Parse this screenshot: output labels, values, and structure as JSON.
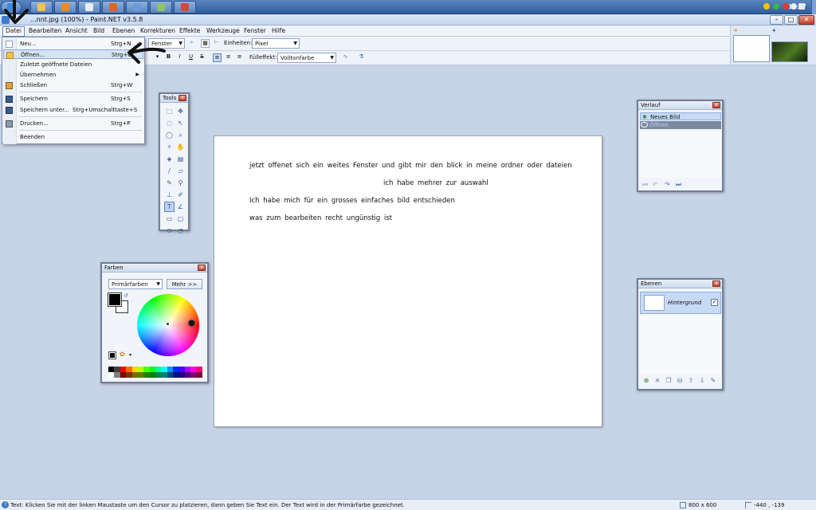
{
  "window": {
    "title": "...nnt.jpg (100%) - Paint.NET v3.5.8",
    "controls": {
      "minimize": "–",
      "maximize": "□",
      "close": "✕"
    }
  },
  "taskbar": {
    "clock": "19:57",
    "buttons": [
      {
        "icon": "windows-orb-icon",
        "color": "#3d8be0"
      },
      {
        "icon": "explorer-icon",
        "color": "#f0c24a"
      },
      {
        "icon": "media-player-icon",
        "color": "#f08a1e"
      },
      {
        "icon": "document-icon",
        "color": "#e8edf5"
      },
      {
        "icon": "firefox-icon",
        "color": "#e0642a"
      },
      {
        "icon": "paint-net-icon",
        "color": "#6d98d8"
      },
      {
        "icon": "image-viewer-icon",
        "color": "#8fc36a"
      },
      {
        "icon": "chrome-icon",
        "color": "#d8463a"
      }
    ]
  },
  "menubar": {
    "items": [
      "Datei",
      "Bearbeiten",
      "Ansicht",
      "Bild",
      "Ebenen",
      "Korrekturen",
      "Effekte",
      "Werkzeuge",
      "Fenster",
      "Hilfe"
    ]
  },
  "toolbar": {
    "font_combo": "Fenster",
    "units_label": "Einheiten:",
    "units_value": "Pixel",
    "fill_label": "Fülleffekt:",
    "fill_value": "Volltonfarbe",
    "style_buttons": [
      "B",
      "I",
      "U",
      "S"
    ]
  },
  "file_menu": {
    "items": [
      {
        "label": "Neu...",
        "shortcut": "Strg+N",
        "icon": "new-file-icon"
      },
      {
        "label": "Öffnen...",
        "shortcut": "Strg+O",
        "icon": "open-folder-icon",
        "highlighted": true
      },
      {
        "label": "Zuletzt geöffnete Dateien",
        "shortcut": "",
        "submenu": true
      },
      {
        "label": "Übernehmen",
        "shortcut": "",
        "submenu": true
      },
      {
        "label": "Schließen",
        "shortcut": "Strg+W",
        "icon": "close-file-icon"
      },
      {
        "label": "Speichern",
        "shortcut": "Strg+S",
        "icon": "save-icon"
      },
      {
        "label": "Speichern unter...",
        "shortcut": "Strg+Umschalttaste+S",
        "icon": "save-as-icon"
      },
      {
        "label": "Drucken...",
        "shortcut": "Strg+P",
        "icon": "print-icon"
      },
      {
        "label": "Beenden",
        "shortcut": ""
      }
    ]
  },
  "canvas": {
    "lines": [
      "jetzt  offenet  sich ein  weites  Fenster  und  gibt  mir den  blick in meine  ordner  oder dateien",
      "ich  habe mehrer  zur auswahl",
      "Ich  habe  mich  für ein  grosses einfaches bild entschieden",
      "was zum bearbeiten recht ungünstig  ist"
    ]
  },
  "tools_panel": {
    "title": "Tools"
  },
  "colors_panel": {
    "title": "Farben",
    "mode_value": "Primärfarben",
    "more_button": "Mehr >>",
    "primary_color": "#000000",
    "secondary_color": "#ffffff",
    "palette": [
      "#000000",
      "#404040",
      "#ff0000",
      "#ff6a00",
      "#ffd800",
      "#b6ff00",
      "#4cff00",
      "#00ff21",
      "#00ff90",
      "#00ffff",
      "#0094ff",
      "#0026ff",
      "#4800ff",
      "#b200ff",
      "#ff00dc",
      "#ff006e",
      "#ffffff",
      "#808080",
      "#7f0000",
      "#7f3300",
      "#7f6a00",
      "#5b7f00",
      "#267f00",
      "#007f0e",
      "#007f46",
      "#007f7f",
      "#004a7f",
      "#00137f",
      "#21007f",
      "#57007f",
      "#7f006e",
      "#7f0037"
    ]
  },
  "history_panel": {
    "title": "Verlauf",
    "items": [
      {
        "label": "Neues Bild",
        "state": "active"
      },
      {
        "label": "Öffnen",
        "state": "selected"
      }
    ]
  },
  "layers_panel": {
    "title": "Ebenen",
    "layers": [
      {
        "name": "Hintergrund",
        "visible": true
      }
    ]
  },
  "thumbnails": {
    "active": "white-image-thumbnail",
    "other": "green-image-thumbnail"
  },
  "statusbar": {
    "text": "Text: Klicken Sie mit der linken Maustaste um den Cursor zu platzieren, dann geben Sie Text ein. Der Text wird in der Primärfarbe gezeichnet.",
    "image_size": "800 x 600",
    "cursor_pos": "-440 , -139"
  },
  "annotations": {
    "arrow_color": "#111111"
  }
}
